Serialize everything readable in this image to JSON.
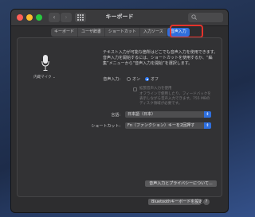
{
  "window": {
    "title": "キーボード"
  },
  "tabs": [
    {
      "label": "キーボード"
    },
    {
      "label": "ユーザ辞書"
    },
    {
      "label": "ショートカット"
    },
    {
      "label": "入力ソース"
    },
    {
      "label": "音声入力",
      "active": true
    }
  ],
  "mic": {
    "label": "内蔵マイク ⌄"
  },
  "description": "テキスト入力が可能な箇所はどこでも音声入力を使用できます。音声入力を開始するには、ショートカットを使用するか、“編集”メニューから“音声入力を開始”を選択します。",
  "dictation": {
    "label": "音声入力:",
    "on_label": "オン",
    "off_label": "オフ",
    "selected": "オフ",
    "enhanced_label": "拡張音声入力を使用",
    "enhanced_note": "オフラインで使用したり、フィードバックを表示しながら音声入力できます。755 MBのディスク領域が必要です。"
  },
  "language": {
    "label": "言語:",
    "value": "日本語（日本）"
  },
  "shortcut": {
    "label": "ショートカット:",
    "value": "Fn（ファンクション）キーを2回押す"
  },
  "buttons": {
    "privacy": "音声入力とプライバシーについて...",
    "bluetooth": "Bluetoothキーボードを設定...",
    "help": "?"
  },
  "colors": {
    "accent": "#2f6fde",
    "annotation": "#e4322b"
  }
}
